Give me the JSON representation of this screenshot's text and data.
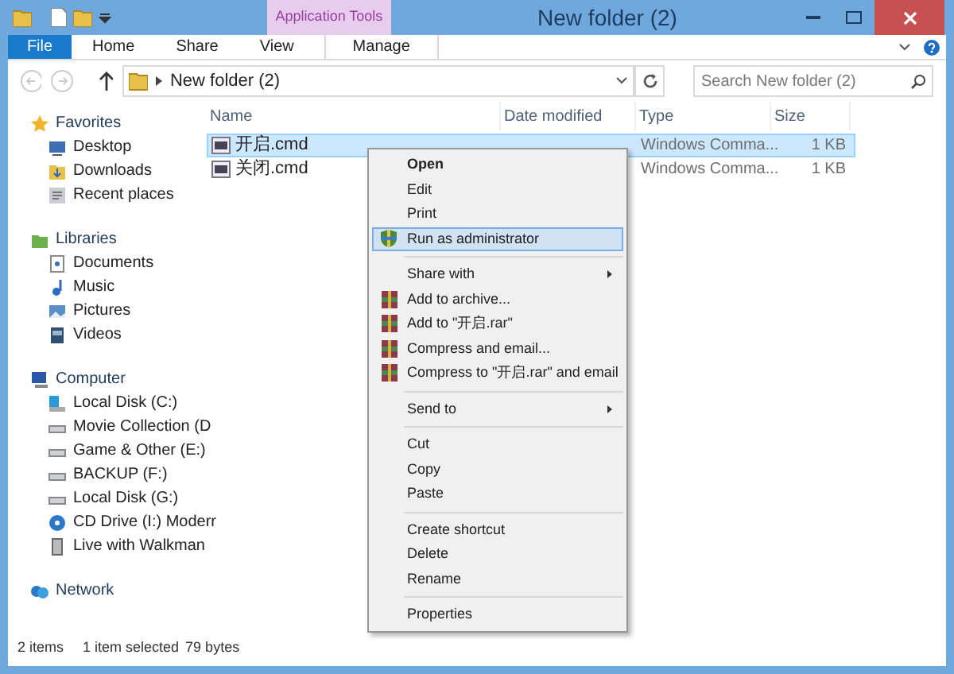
{
  "window": {
    "title": "New folder (2)",
    "context_tab_group": "Application Tools"
  },
  "ribbon_tabs": [
    {
      "label": "File",
      "kind": "file",
      "selected": false
    },
    {
      "label": "Home",
      "kind": "tab",
      "selected": false
    },
    {
      "label": "Share",
      "kind": "tab",
      "selected": false
    },
    {
      "label": "View",
      "kind": "tab",
      "selected": false
    },
    {
      "label": "Manage",
      "kind": "context",
      "selected": false
    }
  ],
  "address_bar": {
    "path": "New folder (2)"
  },
  "search": {
    "placeholder": "Search New folder (2)"
  },
  "navigation": [
    {
      "label": "Favorites",
      "children": [
        {
          "label": "Desktop"
        },
        {
          "label": "Downloads"
        },
        {
          "label": "Recent places"
        }
      ]
    },
    {
      "label": "Libraries",
      "children": [
        {
          "label": "Documents"
        },
        {
          "label": "Music"
        },
        {
          "label": "Pictures"
        },
        {
          "label": "Videos"
        }
      ]
    },
    {
      "label": "Computer",
      "children": [
        {
          "label": "Local Disk (C:)"
        },
        {
          "label": "Movie Collection (D"
        },
        {
          "label": "Game & Other (E:)"
        },
        {
          "label": "BACKUP (F:)"
        },
        {
          "label": "Local Disk (G:)"
        },
        {
          "label": "CD Drive (I:) Moderr"
        },
        {
          "label": "Live with Walkman"
        }
      ]
    },
    {
      "label": "Network"
    }
  ],
  "columns": [
    "Name",
    "Date modified",
    "Type",
    "Size"
  ],
  "files": [
    {
      "name": "开启.cmd",
      "type": "Windows Comma...",
      "size": "1 KB",
      "selected": true
    },
    {
      "name": "关闭.cmd",
      "type": "Windows Comma...",
      "size": "1 KB",
      "selected": false
    }
  ],
  "context_menu": [
    {
      "kind": "item",
      "label": "Open",
      "default": true,
      "submenu": false,
      "selected": false
    },
    {
      "kind": "item",
      "label": "Edit",
      "default": false,
      "submenu": false,
      "selected": false
    },
    {
      "kind": "item",
      "label": "Print",
      "default": false,
      "submenu": false,
      "selected": false
    },
    {
      "kind": "admin",
      "label": "Run as administrator",
      "default": false,
      "submenu": false,
      "selected": true
    },
    {
      "kind": "separator"
    },
    {
      "kind": "item",
      "label": "Share with",
      "default": false,
      "submenu": true,
      "selected": false
    },
    {
      "kind": "archive",
      "label": "Add to archive...",
      "default": false,
      "submenu": false,
      "selected": false
    },
    {
      "kind": "archive",
      "label": "Add to \"开启.rar\"",
      "default": false,
      "submenu": false,
      "selected": false
    },
    {
      "kind": "archive",
      "label": "Compress and email...",
      "default": false,
      "submenu": false,
      "selected": false
    },
    {
      "kind": "archive",
      "label": "Compress to \"开启.rar\" and email",
      "default": false,
      "submenu": false,
      "selected": false
    },
    {
      "kind": "separator"
    },
    {
      "kind": "item",
      "label": "Send to",
      "default": false,
      "submenu": true,
      "selected": false
    },
    {
      "kind": "separator"
    },
    {
      "kind": "item",
      "label": "Cut",
      "default": false,
      "submenu": false,
      "selected": false
    },
    {
      "kind": "item",
      "label": "Copy",
      "default": false,
      "submenu": false,
      "selected": false
    },
    {
      "kind": "item",
      "label": "Paste",
      "default": false,
      "submenu": false,
      "selected": false
    },
    {
      "kind": "separator"
    },
    {
      "kind": "item",
      "label": "Create shortcut",
      "default": false,
      "submenu": false,
      "selected": false
    },
    {
      "kind": "item",
      "label": "Delete",
      "default": false,
      "submenu": false,
      "selected": false
    },
    {
      "kind": "item",
      "label": "Rename",
      "default": false,
      "submenu": false,
      "selected": false
    },
    {
      "kind": "separator"
    },
    {
      "kind": "item",
      "label": "Properties",
      "default": false,
      "submenu": false,
      "selected": false
    }
  ],
  "status_bar": [
    "2 items",
    "1 item selected",
    "79 bytes"
  ]
}
